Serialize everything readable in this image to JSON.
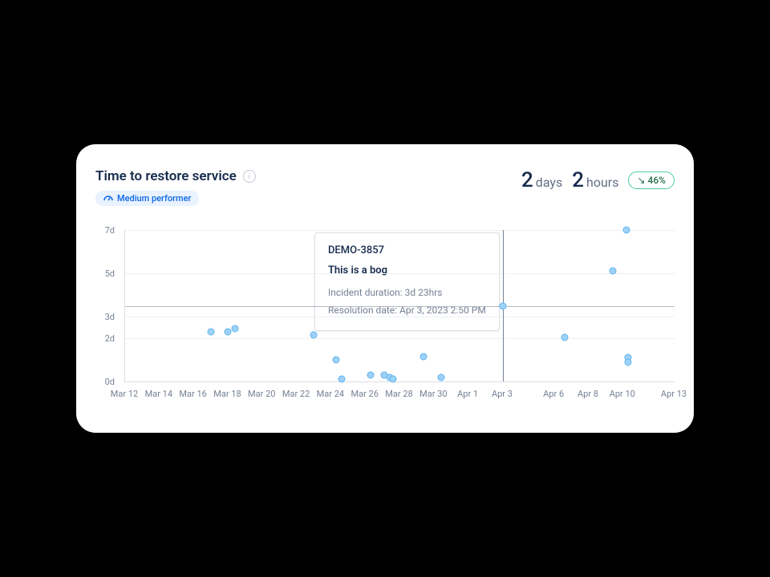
{
  "header": {
    "title": "Time to restore service",
    "badge_label": "Medium performer",
    "metric_days_value": "2",
    "metric_days_unit": "days",
    "metric_hours_value": "2",
    "metric_hours_unit": "hours",
    "trend_value": "46%"
  },
  "tooltip": {
    "id": "DEMO-3857",
    "title": "This is a bog",
    "duration_label": "Incident duration: 3d 23hrs",
    "resolution_label": "Resolution date: Apr 3, 2023 2:50 PM"
  },
  "chart_data": {
    "type": "scatter",
    "title": "Time to restore service",
    "xlabel": "",
    "ylabel": "",
    "y_ticks": [
      "7d",
      "5d",
      "3d",
      "2d",
      "0d"
    ],
    "y_tick_values": [
      7,
      5,
      3,
      2,
      0
    ],
    "ylim": [
      0,
      7
    ],
    "x_ticks": [
      "Mar 12",
      "Mar 14",
      "Mar 16",
      "Mar 18",
      "Mar 20",
      "Mar 22",
      "Mar 24",
      "Mar 26",
      "Mar 28",
      "Mar 30",
      "Apr 1",
      "Apr 3",
      "Apr 6",
      "Apr 8",
      "Apr 10",
      "Apr 13"
    ],
    "x_tick_values": [
      0,
      2,
      4,
      6,
      8,
      10,
      12,
      14,
      16,
      18,
      20,
      22,
      25,
      27,
      29,
      32
    ],
    "xlim": [
      0,
      32
    ],
    "marker_x": 22,
    "reference_y": 3.5,
    "points": [
      {
        "x": 5,
        "y": 2.3
      },
      {
        "x": 6,
        "y": 2.3
      },
      {
        "x": 6.4,
        "y": 2.45
      },
      {
        "x": 11,
        "y": 2.15
      },
      {
        "x": 12.3,
        "y": 1
      },
      {
        "x": 12.6,
        "y": 0.1
      },
      {
        "x": 14.3,
        "y": 0.3
      },
      {
        "x": 15.1,
        "y": 0.3
      },
      {
        "x": 15.4,
        "y": 0.2
      },
      {
        "x": 15.6,
        "y": 0.1
      },
      {
        "x": 17.4,
        "y": 1.15
      },
      {
        "x": 18.4,
        "y": 0.2
      },
      {
        "x": 22,
        "y": 3.5
      },
      {
        "x": 25.6,
        "y": 2.05
      },
      {
        "x": 28.4,
        "y": 5.1
      },
      {
        "x": 29.2,
        "y": 7
      },
      {
        "x": 29.3,
        "y": 1.1
      },
      {
        "x": 29.3,
        "y": 0.9
      }
    ]
  }
}
